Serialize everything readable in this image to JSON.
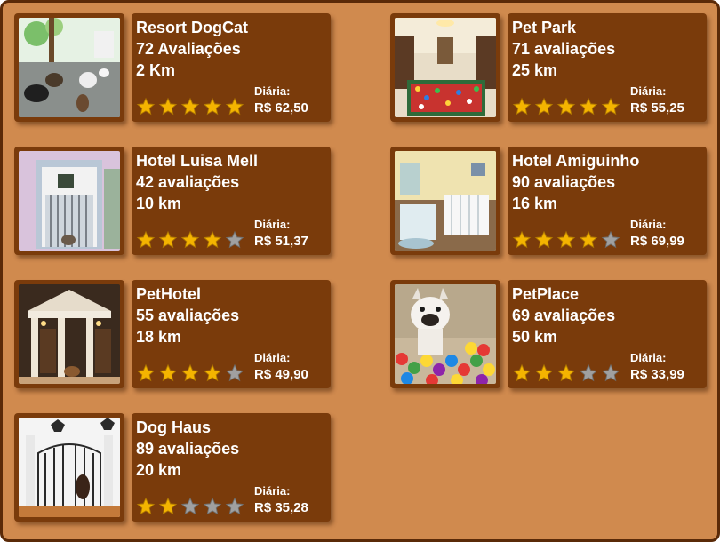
{
  "colors": {
    "background": "#d08a4e",
    "card": "#7a3b0b",
    "border": "#5a2a08",
    "star_filled": "#f4b400",
    "star_empty": "#a0a0a0"
  },
  "price_label": "Diária:",
  "hotels": [
    {
      "name": "Resort DogCat",
      "reviews": "72 Avaliações",
      "distance": "2 Km",
      "price": "R$ 62,50",
      "rating": 5,
      "image": "dogs-playroom-photo"
    },
    {
      "name": "Pet Park",
      "reviews": "71 avaliações",
      "distance": "25 km",
      "price": "R$ 55,25",
      "rating": 5,
      "image": "ball-pit-room-photo"
    },
    {
      "name": "Hotel Luisa Mell",
      "reviews": "42 avaliações",
      "distance": "10 km",
      "price": "R$ 51,37",
      "rating": 4,
      "image": "dog-kennel-photo"
    },
    {
      "name": "Hotel Amiguinho",
      "reviews": "90 avaliações",
      "distance": "16 km",
      "price": "R$ 69,99",
      "rating": 4,
      "image": "dog-bedrooms-photo"
    },
    {
      "name": "PetHotel",
      "reviews": "55 avaliações",
      "distance": "18 km",
      "price": "R$ 49,90",
      "rating": 4,
      "image": "luxury-dog-suites-photo"
    },
    {
      "name": "PetPlace",
      "reviews": "69 avaliações",
      "distance": "50 km",
      "price": "R$ 33,99",
      "rating": 3,
      "image": "bulldog-ball-pit-photo"
    },
    {
      "name": "Dog Haus",
      "reviews": "89 avaliações",
      "distance": "20 km",
      "price": "R$ 35,28",
      "rating": 2,
      "image": "dog-house-gates-photo"
    }
  ]
}
